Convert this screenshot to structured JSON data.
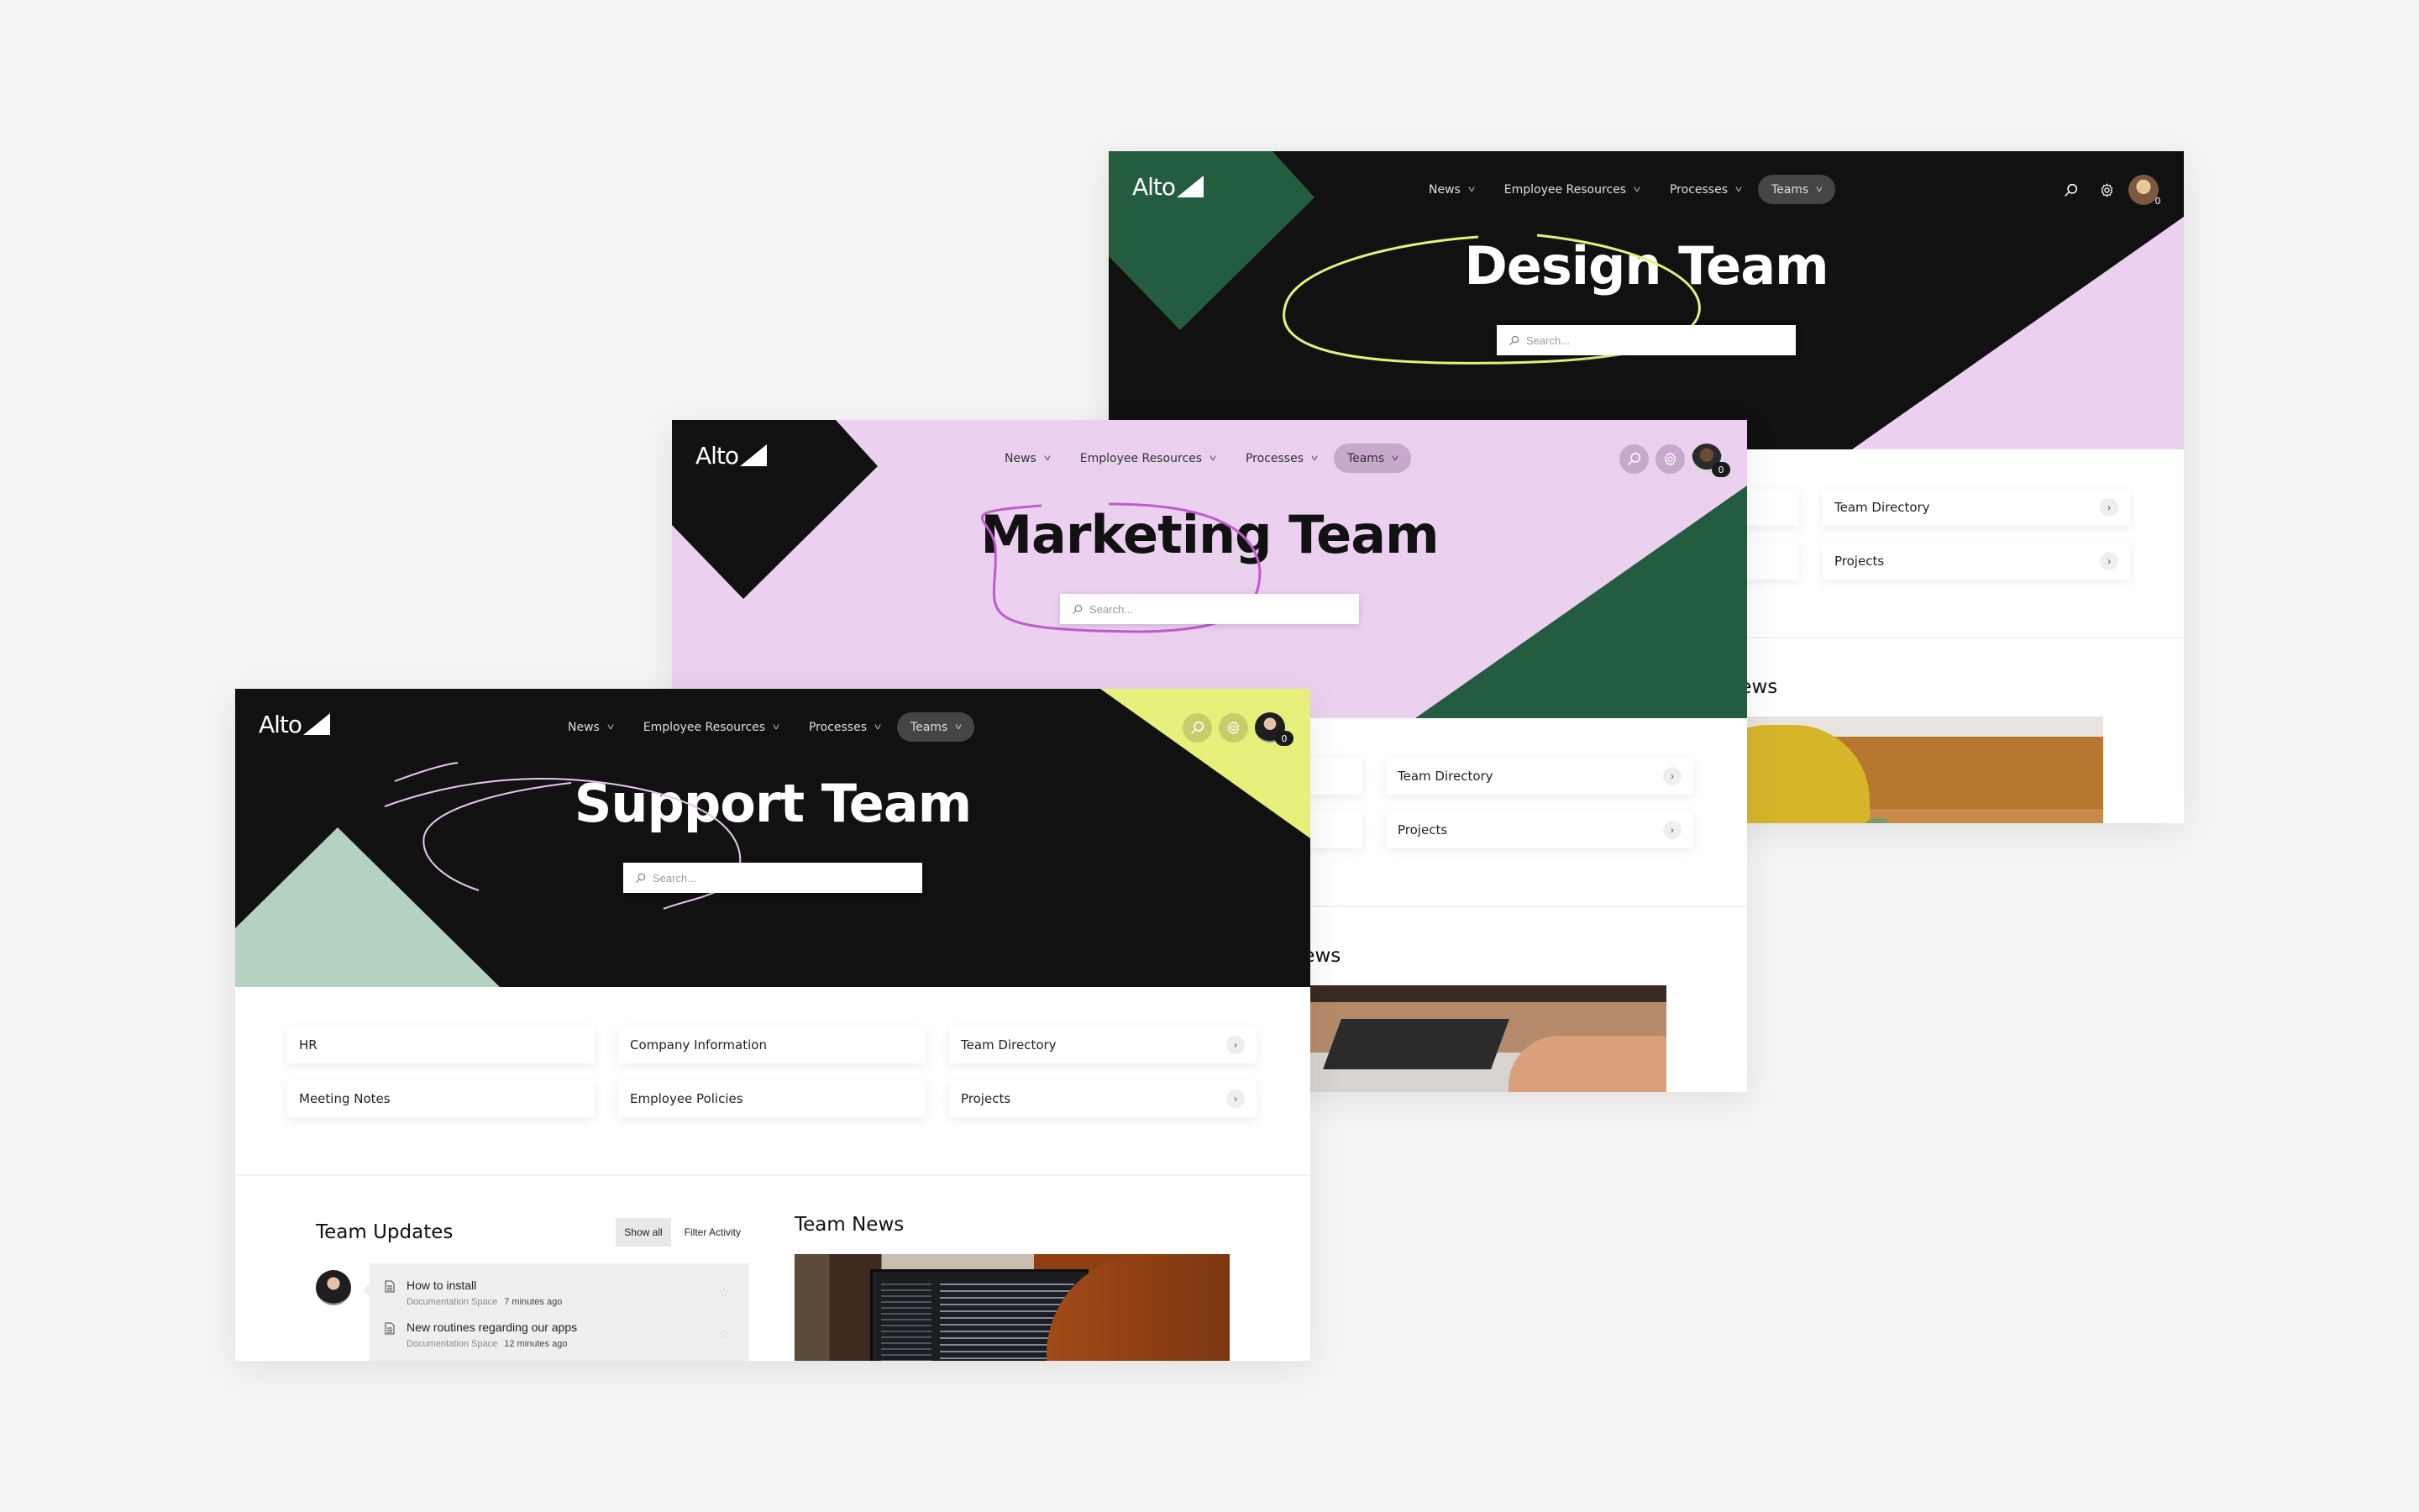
{
  "colors": {
    "page_bg": "#f4f4f4",
    "black": "#111111",
    "lilac": "#ebd0f0",
    "forest": "#245c40",
    "lime": "#e6f07a",
    "mint": "#b4d2bf",
    "scribble_yellow": "#e6f07a",
    "scribble_purple": "#c25ad0",
    "scribble_lilac": "#e7c7f0"
  },
  "brand": {
    "logo": "Alto"
  },
  "nav": {
    "items": [
      {
        "label": "News",
        "chevron": "chevron-down-icon"
      },
      {
        "label": "Employee Resources",
        "chevron": "chevron-down-icon"
      },
      {
        "label": "Processes",
        "chevron": "chevron-down-icon"
      },
      {
        "label": "Teams",
        "chevron": "chevron-down-icon",
        "active": true
      }
    ],
    "icons": [
      "search-icon",
      "gear-icon",
      "avatar"
    ],
    "notification_count": "0"
  },
  "search": {
    "placeholder": "Search..."
  },
  "pages": {
    "design": {
      "title": "Design Team",
      "quick_links": [
        {
          "label": "Team Directory"
        },
        {
          "label": "Projects"
        }
      ],
      "news_title_partial": "lews"
    },
    "marketing": {
      "title": "Marketing Team",
      "quick_links": [
        {
          "label": "Team Directory"
        },
        {
          "label": "Projects"
        }
      ],
      "news_title_partial": "lews"
    },
    "support": {
      "title": "Support Team",
      "quick_links": [
        {
          "label": "HR"
        },
        {
          "label": "Company Information"
        },
        {
          "label": "Team Directory",
          "has_arrow": true
        },
        {
          "label": "Meeting Notes"
        },
        {
          "label": "Employee Policies"
        },
        {
          "label": "Projects",
          "has_arrow": true
        }
      ],
      "updates": {
        "title": "Team Updates",
        "filters": [
          "Show all",
          "Filter Activity"
        ],
        "active_filter": "Show all",
        "items": [
          {
            "title": "How to install",
            "space": "Documentation Space",
            "time": "7 minutes ago"
          },
          {
            "title": "New routines regarding our apps",
            "space": "Documentation Space",
            "time": "12 minutes ago"
          }
        ]
      },
      "news": {
        "title": "Team News"
      }
    }
  }
}
